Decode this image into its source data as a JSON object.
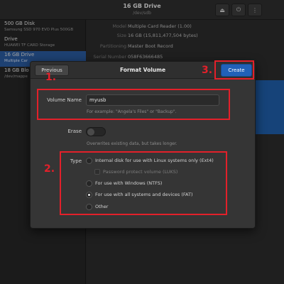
{
  "window": {
    "title": "16 GB Drive",
    "subtitle": "/dev/sdb",
    "icons": [
      "eject-icon",
      "power-icon",
      "menu-icon"
    ]
  },
  "sidebar": {
    "items": [
      {
        "name": "500 GB Disk",
        "desc": "Samsung SSD 970 EVO Plus 500GB",
        "selected": false
      },
      {
        "name": "Drive",
        "desc": "HUAWEI TF CARD Storage",
        "selected": false
      },
      {
        "name": "16 GB Drive",
        "desc": "Multiple Car",
        "selected": true
      },
      {
        "name": "18 GB Blo",
        "desc": "/dev/mappe",
        "selected": false
      }
    ]
  },
  "info": {
    "rows": [
      {
        "key": "Model",
        "value": "Multiple Card Reader (1.00)"
      },
      {
        "key": "Size",
        "value": "16 GB (15,811,477,504 bytes)"
      },
      {
        "key": "Partitioning",
        "value": "Master Boot Record"
      },
      {
        "key": "Serial Number",
        "value": "058F63666485"
      }
    ]
  },
  "dialog": {
    "title": "Format Volume",
    "previous_label": "Previous",
    "create_label": "Create",
    "volume_name_label": "Volume Name",
    "volume_name_value": "myusb",
    "volume_name_hint": "For example: \"Angela's Files\" or \"Backup\".",
    "erase_label": "Erase",
    "erase_on": false,
    "erase_hint": "Overwrites existing data, but takes longer.",
    "type_label": "Type",
    "type_options": [
      {
        "label": "Internal disk for use with Linux systems only (Ext4)",
        "selected": false
      },
      {
        "label": "For use with Windows (NTFS)",
        "selected": false
      },
      {
        "label": "For use with all systems and devices (FAT)",
        "selected": true
      },
      {
        "label": "Other",
        "selected": false
      }
    ],
    "password_protect_label": "Password protect volume (LUKS)"
  },
  "annotations": {
    "step1": "1.",
    "step2": "2.",
    "step3": "3.",
    "color": "#e3202a"
  },
  "colors": {
    "accent": "#2161b8",
    "selection": "#2a5a9e"
  }
}
